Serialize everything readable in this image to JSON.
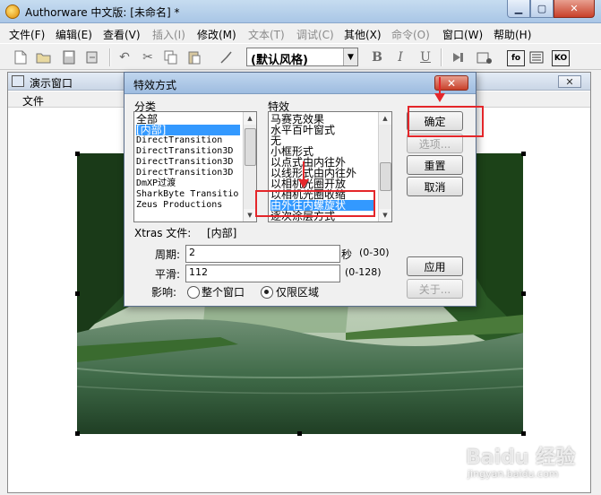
{
  "window": {
    "title": "Authorware 中文版: [未命名] *",
    "minimize": "▁",
    "maximize": "▢",
    "close": "✕"
  },
  "menu": [
    {
      "label": "文件(F)",
      "enabled": true
    },
    {
      "label": "编辑(E)",
      "enabled": true
    },
    {
      "label": "查看(V)",
      "enabled": true
    },
    {
      "label": "插入(I)",
      "enabled": false
    },
    {
      "label": "修改(M)",
      "enabled": true
    },
    {
      "label": "文本(T)",
      "enabled": false
    },
    {
      "label": "调试(C)",
      "enabled": false
    },
    {
      "label": "其他(X)",
      "enabled": true
    },
    {
      "label": "命令(O)",
      "enabled": false
    },
    {
      "label": "窗口(W)",
      "enabled": true
    },
    {
      "label": "帮助(H)",
      "enabled": true
    }
  ],
  "toolbar": {
    "style_value": "(默认风格)",
    "style_arrow": "▼",
    "bold": "B",
    "italic": "I",
    "underline": "U",
    "fo_label": "fo",
    "ko_label": "KO"
  },
  "presentation": {
    "title": "演示窗口",
    "close": "✕",
    "menu_file": "文件"
  },
  "dialog": {
    "title": "特效方式",
    "close": "✕",
    "category_label": "分类",
    "categories": [
      "全部",
      "[内部]",
      "DirectTransition",
      "DirectTransition3D",
      "DirectTransition3D",
      "DirectTransition3D",
      "DmXP过渡",
      "SharkByte Transitio",
      "Zeus Productions"
    ],
    "category_selected": 1,
    "effects_label": "特效",
    "effects": [
      "马赛克效果",
      "水平百叶窗式",
      "无",
      "小框形式",
      "以点式由内往外",
      "以线形式由内往外",
      "以相机光圈开放",
      "以相机光圈收缩",
      "由外往内螺旋状",
      "逐次涂层方式"
    ],
    "effect_selected": 8,
    "xtras_label": "Xtras 文件:",
    "xtras_value": "[内部]",
    "period_label": "周期:",
    "period_value": "2",
    "period_unit": "秒",
    "period_range": "(0-30)",
    "smooth_label": "平滑:",
    "smooth_value": "112",
    "smooth_range": "(0-128)",
    "affect_label": "影响:",
    "affect_options": [
      "整个窗口",
      "仅限区域"
    ],
    "affect_selected": 1,
    "buttons": {
      "ok": "确定",
      "options": "选项...",
      "reset": "重置",
      "cancel": "取消",
      "apply": "应用",
      "about": "关于..."
    }
  },
  "watermark": {
    "brand": "Baidu 经验",
    "url": "jingyan.baidu.com"
  },
  "colors": {
    "selection": "#3399ff",
    "annotation": "#e4262a"
  }
}
